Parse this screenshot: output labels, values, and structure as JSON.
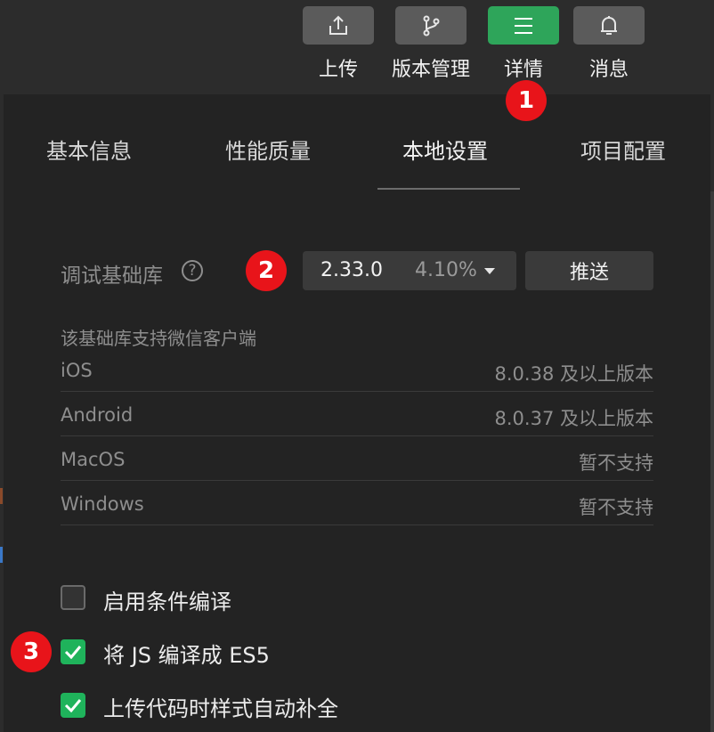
{
  "toolbar": {
    "buttons": [
      {
        "label": "上传",
        "icon": "upload-icon",
        "active": false
      },
      {
        "label": "版本管理",
        "icon": "branch-icon",
        "active": false
      },
      {
        "label": "详情",
        "icon": "menu-icon",
        "active": true
      },
      {
        "label": "消息",
        "icon": "bell-icon",
        "active": false
      }
    ]
  },
  "tabs": [
    {
      "label": "基本信息",
      "active": false
    },
    {
      "label": "性能质量",
      "active": false
    },
    {
      "label": "本地设置",
      "active": true
    },
    {
      "label": "项目配置",
      "active": false
    }
  ],
  "badges": {
    "one": "1",
    "two": "2",
    "three": "3"
  },
  "debug_lib": {
    "label": "调试基础库",
    "help_icon": "?",
    "version": "2.33.0",
    "percent": "4.10%",
    "push_label": "推送"
  },
  "support": {
    "heading": "该基础库支持微信客户端",
    "rows": [
      {
        "platform": "iOS",
        "value": "8.0.38 及以上版本"
      },
      {
        "platform": "Android",
        "value": "8.0.37 及以上版本"
      },
      {
        "platform": "MacOS",
        "value": "暂不支持"
      },
      {
        "platform": "Windows",
        "value": "暂不支持"
      }
    ]
  },
  "options": [
    {
      "label": "启用条件编译",
      "checked": false
    },
    {
      "label": "将 JS 编译成 ES5",
      "checked": true
    },
    {
      "label": "上传代码时样式自动补全",
      "checked": true
    }
  ],
  "colors": {
    "accent": "#2ea55a",
    "badge": "#e8141a",
    "checkbox": "#1fb35b"
  }
}
